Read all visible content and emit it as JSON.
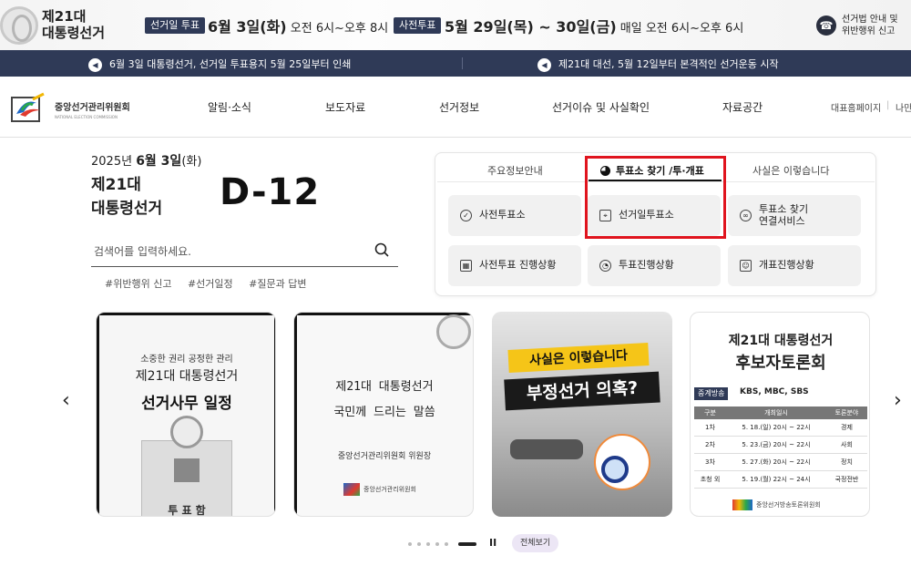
{
  "top": {
    "election_title": [
      "제21대",
      "대통령선거"
    ],
    "election_day": {
      "badge": "선거일 투표",
      "date": "6월 3일(화)",
      "time": "오전 6시~오후 8시"
    },
    "early_vote": {
      "badge": "사전투표",
      "date": "5월 29일(목) ~ 30일(금)",
      "time": "매일 오전 6시~오후 6시"
    },
    "law_info": [
      "선거법 안내 및",
      "위반행위 신고"
    ]
  },
  "notices": [
    "6월 3일 대통령선거, 선거일 투표용지 5월 25일부터 인쇄",
    "제21대 대선, 5월 12일부터 본격적인 선거운동 시작"
  ],
  "org": {
    "name": "중앙선거관리위원회",
    "name_en": "NATIONAL ELECTION COMMISSION"
  },
  "menu": [
    "알림·소식",
    "보도자료",
    "선거정보",
    "선거이슈 및 사실확인",
    "자료공간"
  ],
  "utility": [
    "대표홈페이지",
    "나만"
  ],
  "hero": {
    "date_prefix": "2025년",
    "date_main": "6월 3일",
    "date_suffix": "(화)",
    "title": [
      "제21대",
      "대통령선거"
    ],
    "dday": "D-12"
  },
  "search": {
    "placeholder": "검색어를 입력하세요.",
    "tags": [
      "#위반행위 신고",
      "#선거일정",
      "#질문과 답변"
    ]
  },
  "panel": {
    "tabs": [
      "주요정보안내",
      "투표소 찾기 /투·개표",
      "사실은 이렇습니다"
    ],
    "active_tab": 1,
    "buttons": [
      {
        "label": "사전투표소",
        "icon": "check-circle-icon"
      },
      {
        "label": "선거일투표소",
        "icon": "map-icon"
      },
      {
        "label": [
          "투표소 찾기",
          "연결서비스"
        ],
        "icon": "link-icon"
      },
      {
        "label": "사전투표 진행상황",
        "icon": "chart-icon"
      },
      {
        "label": "투표진행상황",
        "icon": "pie-icon"
      },
      {
        "label": "개표진행상황",
        "icon": "person-icon"
      }
    ]
  },
  "cards": [
    {
      "lines": [
        "소중한 권리 공정한 관리",
        "제21대 대통령선거",
        "선거사무 일정"
      ],
      "box_label": "투 표 함"
    },
    {
      "lines": [
        "제21대 대통령선거",
        "국민께 드리는 말씀",
        "중앙선거관리위원회 위원장"
      ],
      "org": "중앙선거관리위원회"
    },
    {
      "lines": [
        "사실은 이렇습니다",
        "부정선거 의혹?"
      ]
    },
    {
      "title": [
        "제21대 대통령선거",
        "후보자토론회"
      ],
      "broadcast_badge": "중계방송",
      "broadcasters": "KBS, MBC, SBS",
      "table": {
        "headers": [
          "구분",
          "개최일시",
          "토론분야"
        ],
        "rows": [
          [
            "1차",
            "5. 18.(일) 20시 ~ 22시",
            "경제"
          ],
          [
            "2차",
            "5. 23.(금) 20시 ~ 22시",
            "사회"
          ],
          [
            "3차",
            "5. 27.(화) 20시 ~ 22시",
            "정치"
          ],
          [
            "초청 외",
            "5. 19.(월) 22시 ~ 24시",
            "국정전반"
          ]
        ]
      },
      "footer": "중앙선거방송토론위원회"
    }
  ],
  "pager": {
    "view_all": "전체보기",
    "pause": "II"
  },
  "arrows": {
    "prev": "‹",
    "next": "›"
  },
  "colors": {
    "navy": "#2f3a57",
    "highlight": "#e0141e",
    "yellow": "#f5c518"
  }
}
